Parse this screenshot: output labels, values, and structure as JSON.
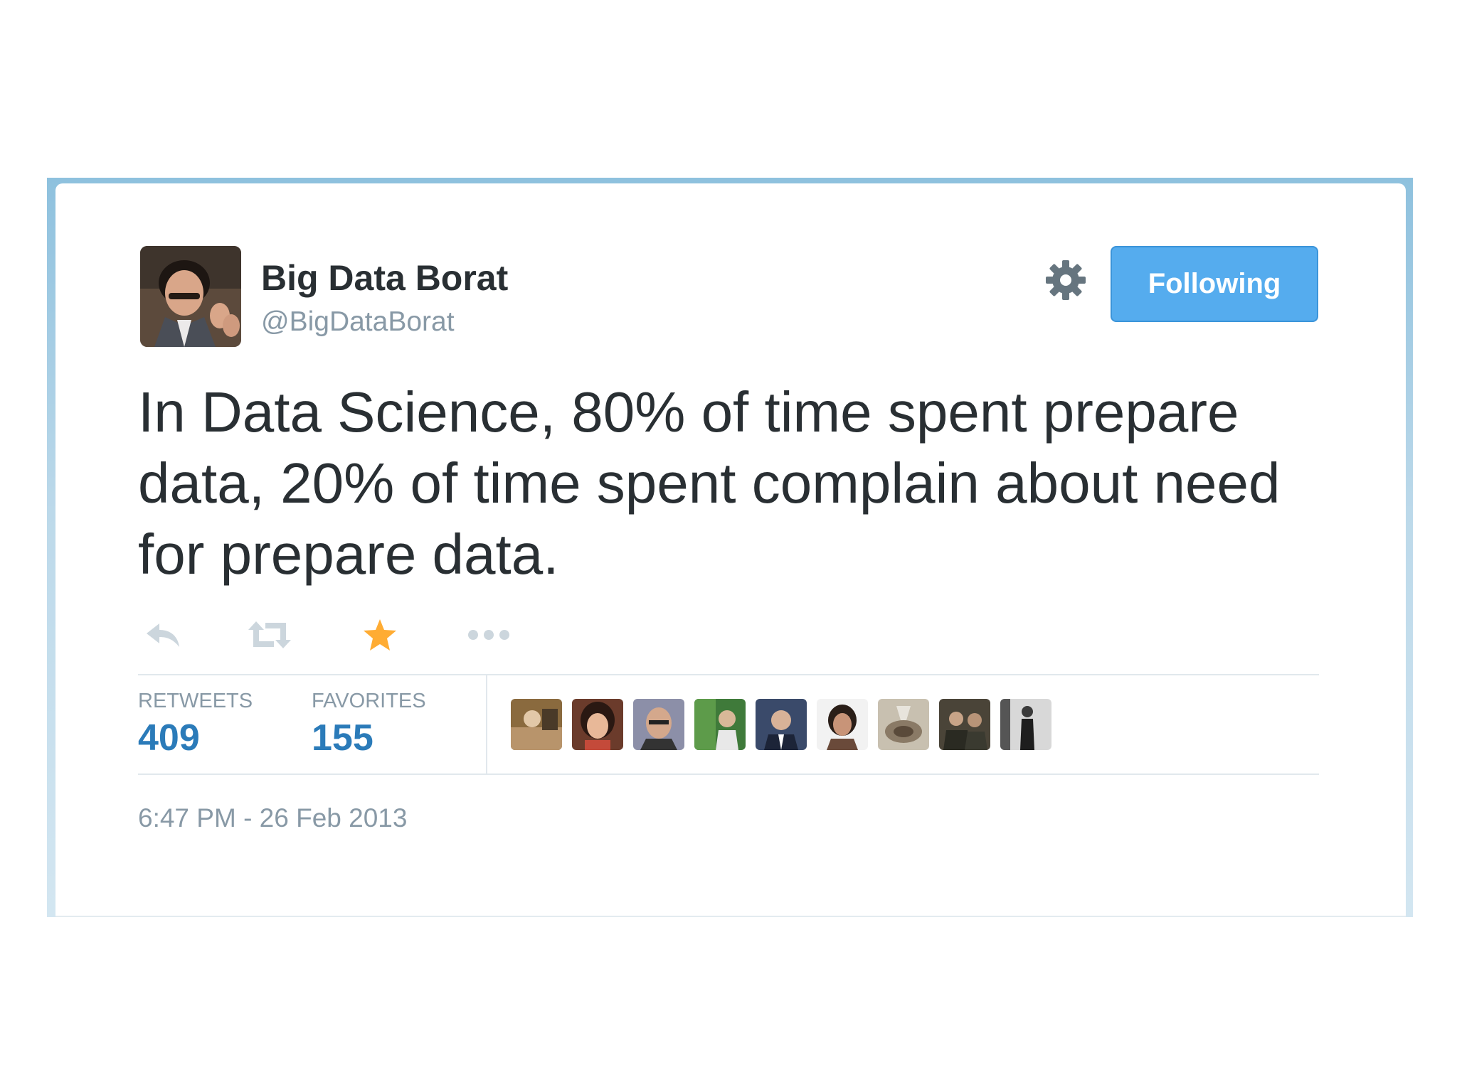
{
  "user": {
    "display_name": "Big Data Borat",
    "screen_name": "@BigDataBorat",
    "follow_button_label": "Following"
  },
  "tweet": {
    "text": "In Data Science, 80% of time spent prepare data, 20% of time spent complain about need for prepare data.",
    "timestamp": "6:47 PM - 26 Feb 2013"
  },
  "actions": [
    {
      "name": "reply",
      "icon": "reply-icon"
    },
    {
      "name": "retweet",
      "icon": "retweet-icon"
    },
    {
      "name": "favorite",
      "icon": "star-icon",
      "active": true,
      "color": "#ffac33"
    },
    {
      "name": "more",
      "icon": "ellipsis-icon"
    }
  ],
  "stats": {
    "retweets_label": "RETWEETS",
    "retweets_count": "409",
    "favorites_label": "FAVORITES",
    "favorites_count": "155"
  },
  "favoriters_count_shown": 9,
  "colors": {
    "accent": "#55acee",
    "stat_value": "#2b7bb9",
    "muted_text": "#8899a6",
    "body_text": "#292f33",
    "star": "#ffac33",
    "frame": "#8ec1de"
  }
}
